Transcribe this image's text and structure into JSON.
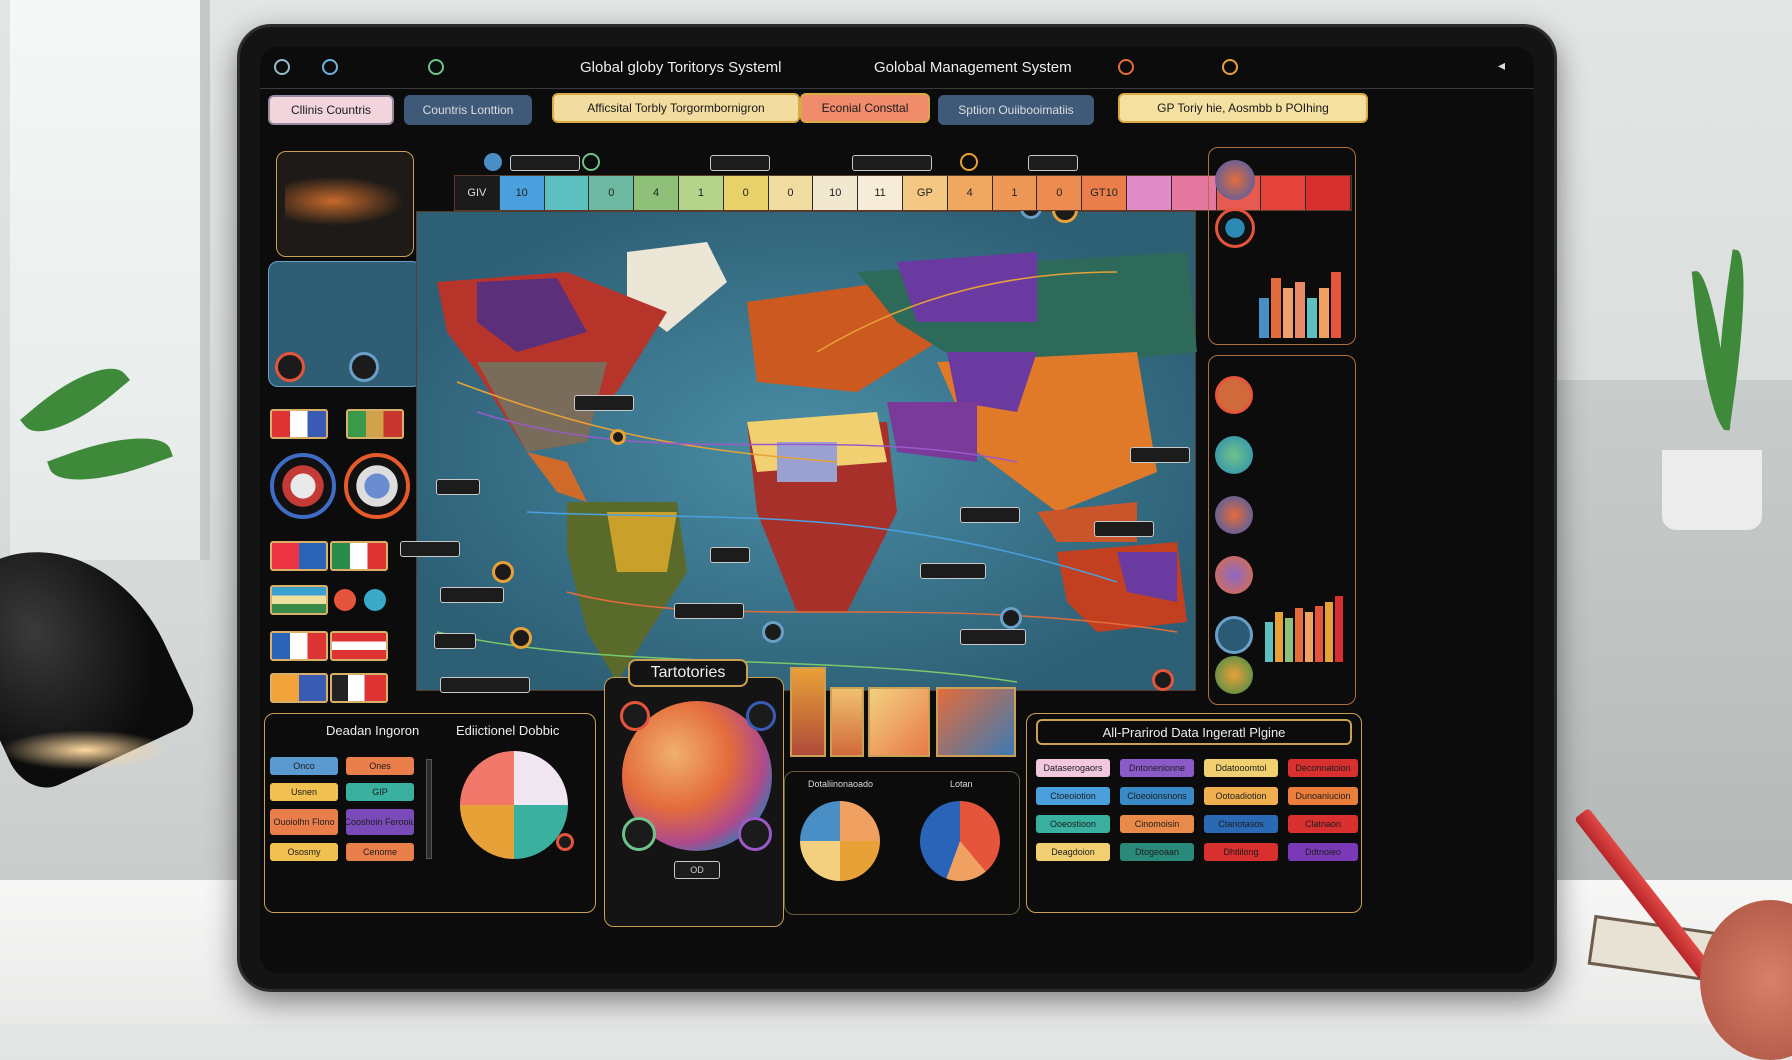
{
  "topbar": {
    "left_items": [
      "",
      "",
      ""
    ],
    "title_left": "Global globy Toritorys Systeml",
    "title_right": "Golobal Management System",
    "right_items": [
      "",
      ""
    ]
  },
  "filters": {
    "row": [
      "Cllinis Countris",
      "Countris Lonttion",
      "Afficsital Torbly Torgormbornigron",
      "Econial Consttal",
      "Sptiion Ouiibooimatiis",
      "GP Toriy hie, Aosmbb b POIhing"
    ]
  },
  "color_strip": [
    "GIV",
    "10",
    "",
    "0",
    "4",
    "1",
    "0",
    "0",
    "10",
    "11",
    "GP",
    "4",
    "1",
    "0",
    "GT10",
    "",
    "",
    "",
    "",
    ""
  ],
  "map_tags": [
    "",
    "",
    "",
    "",
    "",
    "",
    "",
    "",
    "",
    "",
    "",
    "",
    ""
  ],
  "territories": {
    "title": "Tartotories",
    "button": "OD"
  },
  "bottom_left": {
    "title_left": "Deadan Ingoron",
    "title_right": "Ediictionel Dobbic",
    "buttons": [
      "Onco",
      "Ones",
      "Usnen",
      "GIP",
      "Ouoiolhn Flono",
      "Cooshoin Ferooiu",
      "Ososmy",
      "Cenome"
    ]
  },
  "mini_charts": {
    "label_left": "Dotaliinonaoado",
    "label_right": "Lotan"
  },
  "right_bottom": {
    "title": "All-Prarirod Data Ingeratl Plgine",
    "buttons": [
      "Dataserogaors",
      "Dntonenionne",
      "Ddatooomtol",
      "Deconnatoion",
      "Ctoeoiotion",
      "Cloeoionsnons",
      "Ootoadiotion",
      "Dunoaniucion",
      "Ooeostioon",
      "Cinomoisin",
      "Ctanotasos",
      "Clatnaon",
      "Deagdoion",
      "Dtogeoaan",
      "Dhtlilong",
      "Ddtnoieo"
    ]
  },
  "colors": {
    "accent": "#e8a137",
    "screen": "#0c0c0d",
    "ocean": "#3f7f98"
  },
  "icons": [
    "back-icon",
    "globe-icon",
    "settings-icon",
    "alert-icon",
    "profile-icon",
    "menu-icon"
  ]
}
